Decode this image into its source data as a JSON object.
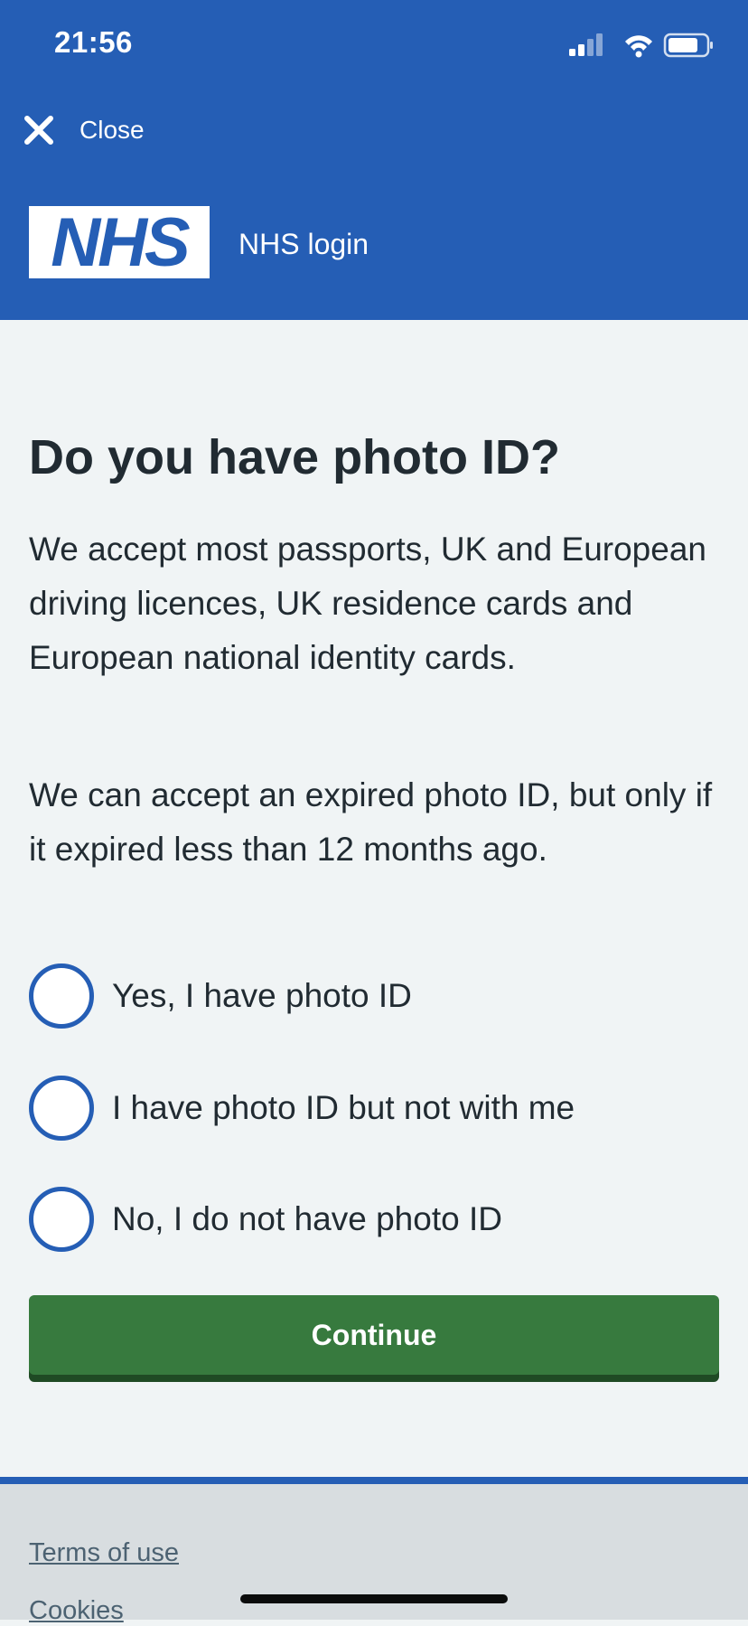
{
  "status_bar": {
    "time": "21:56",
    "signal_icon": "cellular-signal-icon",
    "wifi_icon": "wifi-icon",
    "battery_icon": "battery-icon"
  },
  "header": {
    "close_label": "Close",
    "close_icon": "close-icon",
    "logo_text": "NHS",
    "service_name": "NHS login"
  },
  "main": {
    "title": "Do you have photo ID?",
    "paragraph_1": "We accept most passports, UK and European driving licences, UK residence cards and European national identity cards.",
    "paragraph_2": "We can accept an expired photo ID, but only if it expired less than 12 months ago.",
    "options": [
      {
        "label": "Yes, I have photo ID"
      },
      {
        "label": "I have photo ID but not with me"
      },
      {
        "label": "No, I do not have photo ID"
      }
    ],
    "continue_label": "Continue"
  },
  "footer": {
    "links": [
      {
        "label": "Terms of use"
      },
      {
        "label": "Cookies"
      }
    ]
  },
  "colors": {
    "nhs_blue": "#255eb5",
    "button_green": "#377a3e",
    "page_background": "#f0f4f5",
    "footer_background": "#d8dde0"
  }
}
